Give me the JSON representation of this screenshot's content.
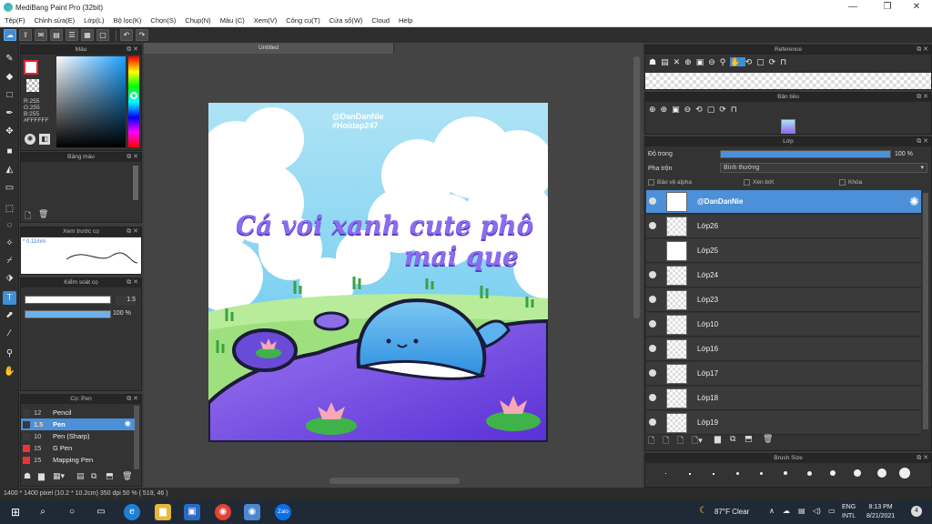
{
  "window": {
    "title": "MediBang Paint Pro (32bit)",
    "minimize": "—",
    "maximize": "❐",
    "close": "✕"
  },
  "menu": [
    "Tệp(F)",
    "Chỉnh sửa(E)",
    "Lớp(L)",
    "Bộ lọc(K)",
    "Chọn(S)",
    "Chụp(N)",
    "Màu (C)",
    "Xem(V)",
    "Công cụ(T)",
    "Cửa sổ(W)",
    "Cloud",
    "Help"
  ],
  "document": {
    "tab_title": "Untitled"
  },
  "color_panel": {
    "title": "Màu",
    "rgb": [
      "R:255",
      "G:255",
      "B:255"
    ],
    "hex": "#FFFFFF",
    "primary_color": "#e8262b",
    "secondary_color": "#ffffff"
  },
  "palette_panel": {
    "title": "Bảng màu"
  },
  "preview_panel": {
    "title": "Xem trước cọ",
    "size": "* 0.11mm"
  },
  "brush_control": {
    "title": "Kiểm soát cọ",
    "size_value": "1.5",
    "opacity_value": "100 %"
  },
  "brush_panel": {
    "title": "Cọ: Pen",
    "brushes": [
      {
        "size": "12",
        "name": "Pencil",
        "color": "#3a3a3a"
      },
      {
        "size": "1.5",
        "name": "Pen",
        "color": "#3a3a3a"
      },
      {
        "size": "10",
        "name": "Pen (Sharp)",
        "color": "#3a3a3a"
      },
      {
        "size": "15",
        "name": "G Pen",
        "color": "#e33"
      },
      {
        "size": "15",
        "name": "Mapping Pen",
        "color": "#e33"
      }
    ]
  },
  "reference_panel": {
    "title": "Reference"
  },
  "navigator_panel": {
    "title": "Bản tiêu"
  },
  "layer_panel": {
    "title": "Lớp",
    "opacity_label": "Độ trong",
    "opacity_value": "100 %",
    "opacity_level": 1.0,
    "blend_label": "Pha trộn",
    "blend_value": "Bình thường",
    "protect_alpha": "Bảo vệ alpha",
    "clipping": "Xén bớt",
    "lock": "Khóa",
    "layers": [
      "@DanDanNie",
      "Lớp26",
      "Lớp25",
      "Lớp24",
      "Lớp23",
      "Lớp10",
      "Lớp16",
      "Lớp17",
      "Lớp18",
      "Lớp19"
    ]
  },
  "brush_size_panel": {
    "title": "Brush Size"
  },
  "artwork": {
    "watermark_1": "@DanDanNie",
    "watermark_2": "#Hoidap247",
    "headline_1": "Cá voi xanh cute phô",
    "headline_2": "mai que"
  },
  "status": {
    "text": "1400 * 1400 pixel   (10.2 * 10.2cm)   350 dpi   50 %   ( 519, 46 )"
  },
  "taskbar": {
    "search": "⌕",
    "weather": "87°F  Clear",
    "lang_1": "ENG",
    "lang_2": "INTL",
    "time": "8:13 PM",
    "date": "8/21/2021",
    "badge": "4"
  }
}
